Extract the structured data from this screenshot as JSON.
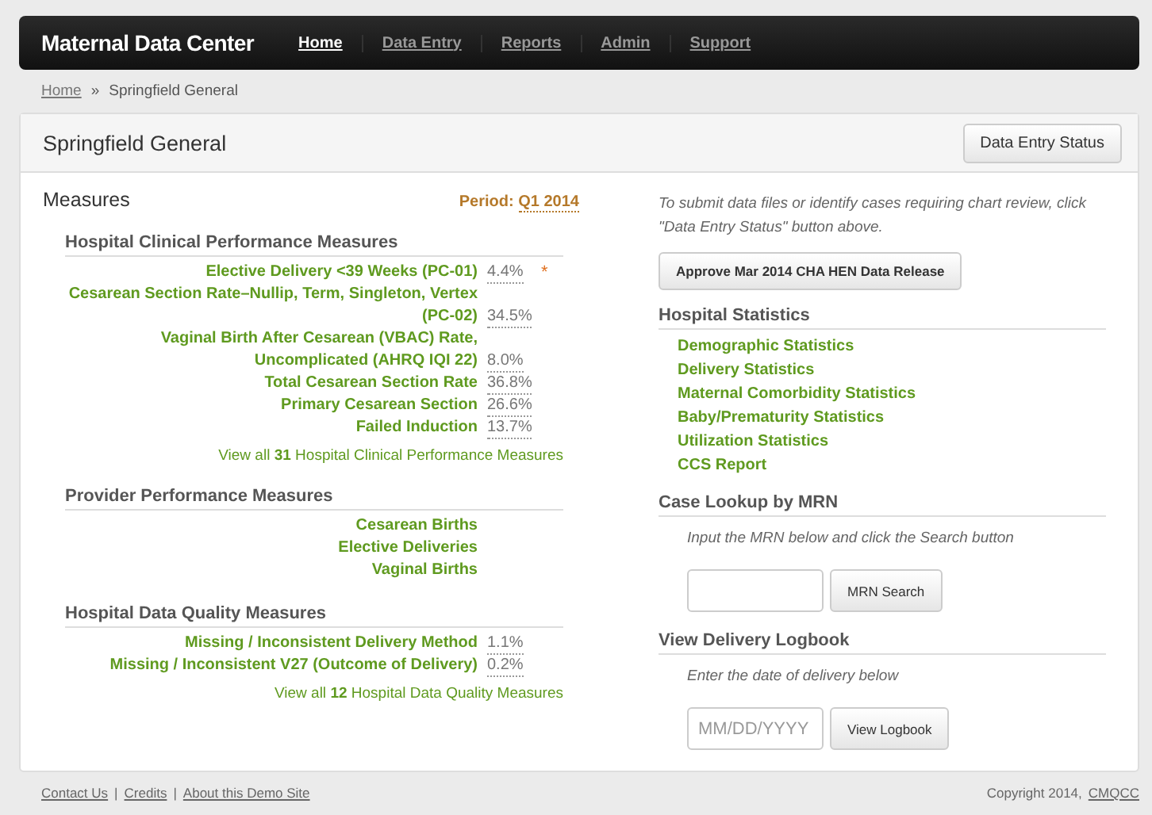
{
  "navbar": {
    "brand": "Maternal Data Center",
    "items": [
      {
        "label": "Home",
        "selected": true
      },
      {
        "label": "Data Entry",
        "selected": false
      },
      {
        "label": "Reports",
        "selected": false
      },
      {
        "label": "Admin",
        "selected": false
      },
      {
        "label": "Support",
        "selected": false
      }
    ]
  },
  "breadcrumb": {
    "items": [
      "Home",
      "Springfield General"
    ],
    "separator": "»"
  },
  "panel": {
    "title": "Springfield General",
    "button": "Data Entry Status"
  },
  "measures": {
    "title": "Measures",
    "period_label": "Period:",
    "period": "Q1 2014",
    "groups": [
      {
        "title": "Hospital Clinical Performance Measures",
        "rows": [
          {
            "label": "Elective Delivery <39 Weeks (PC-01)",
            "value": "4.4%",
            "note": "*"
          },
          {
            "label": "Cesarean Section Rate–Nullip, Term, Singleton, Vertex (PC-02)",
            "value": "34.5%"
          },
          {
            "label": "Vaginal Birth After Cesarean (VBAC) Rate, Uncomplicated (AHRQ IQI 22)",
            "value": "8.0%"
          },
          {
            "label": "Total Cesarean Section Rate",
            "value": "36.8%"
          },
          {
            "label": "Primary Cesarean Section",
            "value": "26.6%"
          },
          {
            "label": "Failed Induction",
            "value": "13.7%"
          }
        ],
        "view_all": "View all **31** Hospital Clinical Performance Measures"
      },
      {
        "title": "Provider Performance Measures",
        "rows": [
          {
            "label": "Cesarean Births"
          },
          {
            "label": "Elective Deliveries"
          },
          {
            "label": "Vaginal Births"
          }
        ]
      },
      {
        "title": "Hospital Data Quality Measures",
        "rows": [
          {
            "label": "Missing / Inconsistent Delivery Method",
            "value": "1.1%"
          },
          {
            "label": "Missing / Inconsistent V27 (Outcome of Delivery)",
            "value": "0.2%"
          }
        ],
        "view_all": "View all **12** Hospital Data Quality Measures"
      }
    ]
  },
  "sidebar": {
    "intro": "To submit data files or identify cases requiring chart review, click \"Data Entry Status\" button above.",
    "approve_button": "Approve Mar 2014 CHA HEN Data Release",
    "statistics": {
      "title": "Hospital Statistics",
      "links": [
        "Demographic Statistics",
        "Delivery Statistics",
        "Maternal Comorbidity Statistics",
        "Baby/Prematurity Statistics",
        "Utilization Statistics",
        "CCS Report"
      ]
    },
    "mrn_lookup": {
      "title": "Case Lookup by MRN",
      "hint": "Input the MRN below and click the Search button",
      "button": "MRN Search"
    },
    "logbook": {
      "title": "View Delivery Logbook",
      "hint": "Enter the date of delivery below",
      "placeholder": "MM/DD/YYYY",
      "button": "View Logbook"
    }
  },
  "footer": {
    "links": [
      "Contact Us",
      "Credits",
      "About this Demo Site"
    ],
    "separator": "|",
    "copyright": "Copyright 2014,",
    "copyright_link": "CMQCC"
  }
}
